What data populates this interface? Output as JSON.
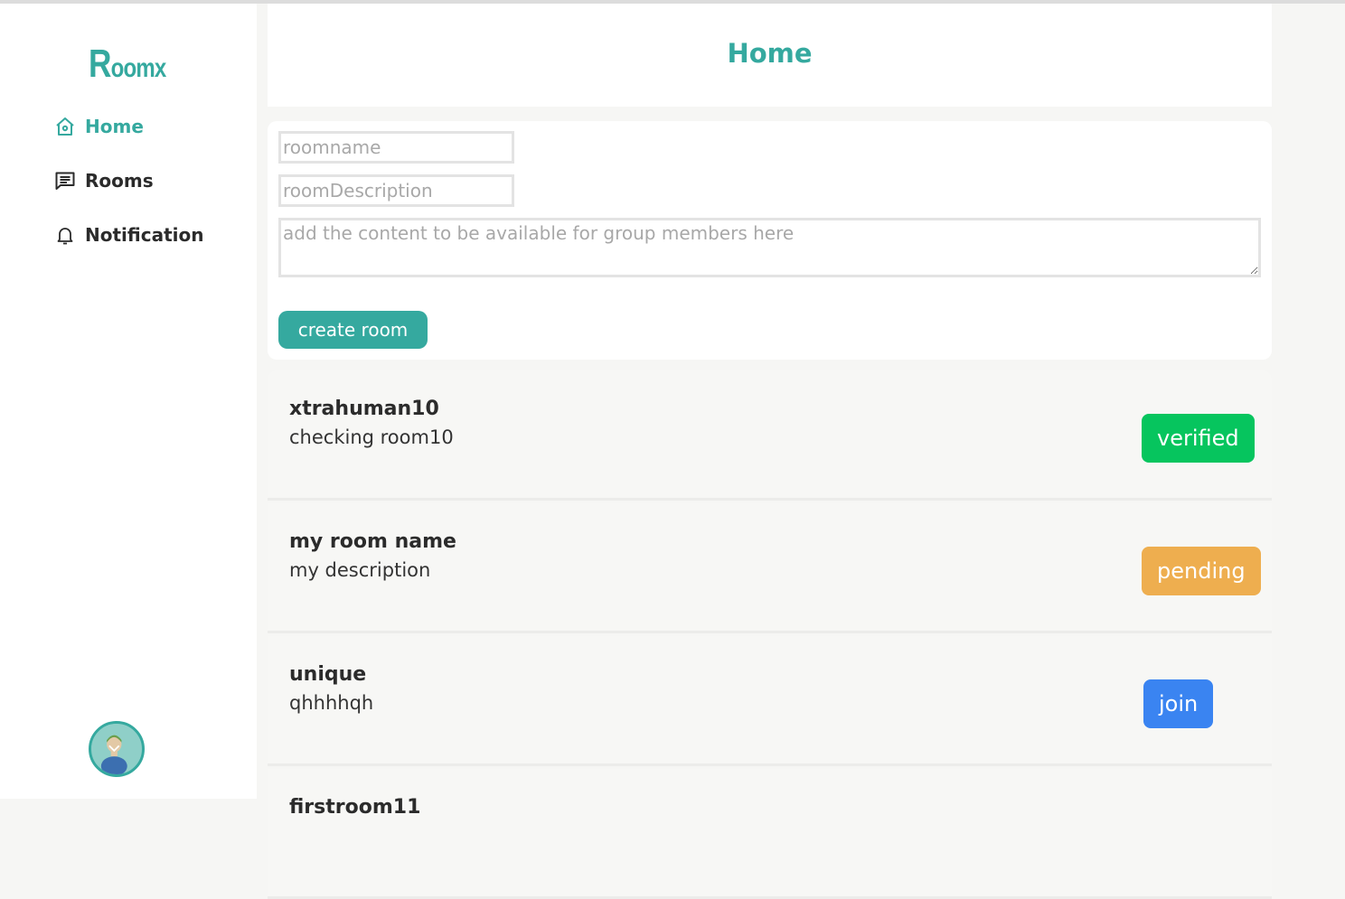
{
  "app": {
    "logo_initial": "R",
    "logo_rest": "oomx"
  },
  "sidebar": {
    "items": [
      {
        "label": "Home",
        "icon": "home-icon",
        "active": true
      },
      {
        "label": "Rooms",
        "icon": "chat-icon",
        "active": false
      },
      {
        "label": "Notification",
        "icon": "bell-icon",
        "active": false
      }
    ]
  },
  "header": {
    "title": "Home"
  },
  "form": {
    "name_placeholder": "roomname",
    "desc_placeholder": "roomDescription",
    "content_placeholder": "add the content to be available for group members here",
    "create_label": "create room"
  },
  "rooms": [
    {
      "name": "xtrahuman10",
      "description": "checking room10",
      "status": "verified",
      "status_color": "#06c55e"
    },
    {
      "name": "my room name",
      "description": "my description",
      "status": "pending",
      "status_color": "#eeae4f"
    },
    {
      "name": "unique",
      "description": "qhhhhqh",
      "status": "join",
      "status_color": "#3a84f1"
    },
    {
      "name": "firstroom11",
      "description": "",
      "status": "",
      "status_color": "#06c55e"
    }
  ],
  "colors": {
    "accent": "#35a99f"
  }
}
